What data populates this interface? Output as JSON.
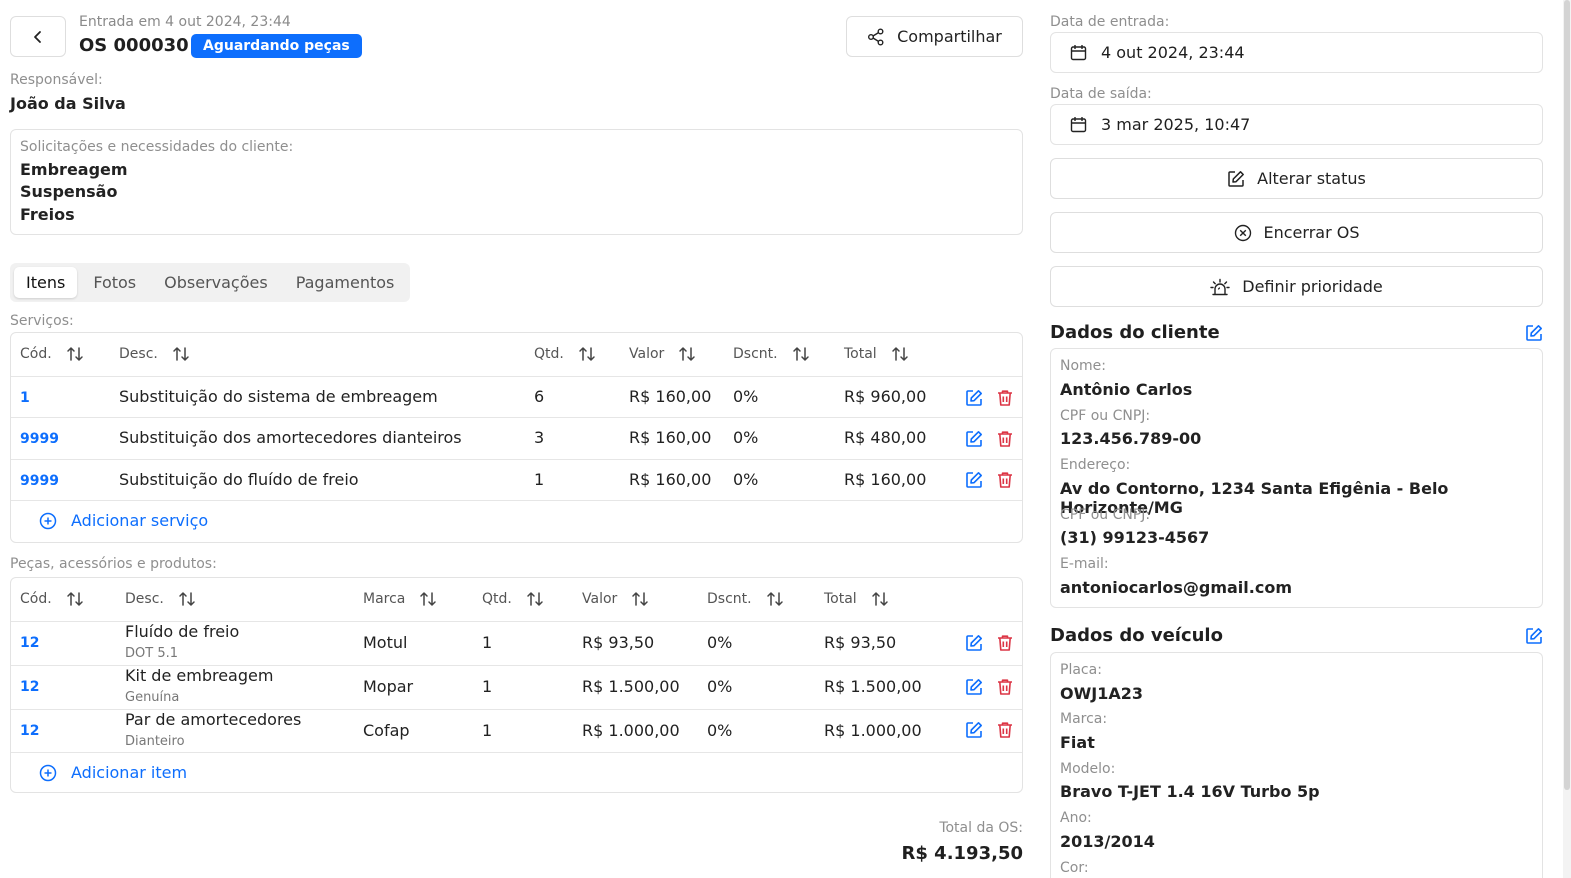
{
  "header": {
    "entry_note": "Entrada em 4 out 2024, 23:44",
    "os_number": "OS 000030",
    "status_badge": "Aguardando peças",
    "share_label": "Compartilhar"
  },
  "responsible": {
    "label": "Responsável:",
    "name": "João da Silva"
  },
  "requests": {
    "label": "Solicitações e necessidades do cliente:",
    "items": [
      "Embreagem",
      "Suspensão",
      "Freios"
    ]
  },
  "tabs": [
    "Itens",
    "Fotos",
    "Observações",
    "Pagamentos"
  ],
  "services": {
    "section_label": "Serviços:",
    "headers": [
      "Cód.",
      "Desc.",
      "Qtd.",
      "Valor",
      "Dscnt.",
      "Total"
    ],
    "rows": [
      {
        "code": "1",
        "desc": "Substituição do sistema de embreagem",
        "qty": "6",
        "value": "R$ 160,00",
        "discount": "0%",
        "total": "R$ 960,00"
      },
      {
        "code": "9999",
        "desc": "Substituição dos amortecedores dianteiros",
        "qty": "3",
        "value": "R$ 160,00",
        "discount": "0%",
        "total": "R$ 480,00"
      },
      {
        "code": "9999",
        "desc": "Substituição do fluído de freio",
        "qty": "1",
        "value": "R$ 160,00",
        "discount": "0%",
        "total": "R$ 160,00"
      }
    ],
    "add_label": "Adicionar serviço"
  },
  "parts": {
    "section_label": "Peças, acessórios e produtos:",
    "headers": [
      "Cód.",
      "Desc.",
      "Marca",
      "Qtd.",
      "Valor",
      "Dscnt.",
      "Total"
    ],
    "rows": [
      {
        "code": "12",
        "desc": "Fluído de freio",
        "sub": "DOT 5.1",
        "brand": "Motul",
        "qty": "1",
        "value": "R$ 93,50",
        "discount": "0%",
        "total": "R$ 93,50"
      },
      {
        "code": "12",
        "desc": "Kit de embreagem",
        "sub": "Genuína",
        "brand": "Mopar",
        "qty": "1",
        "value": "R$ 1.500,00",
        "discount": "0%",
        "total": "R$ 1.500,00"
      },
      {
        "code": "12",
        "desc": "Par de amortecedores",
        "sub": "Dianteiro",
        "brand": "Cofap",
        "qty": "1",
        "value": "R$ 1.000,00",
        "discount": "0%",
        "total": "R$ 1.000,00"
      }
    ],
    "add_label": "Adicionar item"
  },
  "total": {
    "label": "Total da OS:",
    "value": "R$ 4.193,50"
  },
  "dates": {
    "entry_label": "Data de entrada:",
    "entry_value": "4 out 2024, 23:44",
    "exit_label": "Data de saída:",
    "exit_value": "3 mar 2025, 10:47"
  },
  "actions": {
    "change_status": "Alterar status",
    "close_os": "Encerrar OS",
    "set_priority": "Definir prioridade"
  },
  "client": {
    "title": "Dados do cliente",
    "fields": [
      {
        "label": "Nome:",
        "value": "Antônio Carlos"
      },
      {
        "label": "CPF ou CNPJ:",
        "value": "123.456.789-00"
      },
      {
        "label": "Endereço:",
        "value": "Av do Contorno, 1234 Santa Efigênia - Belo Horizonte/MG"
      },
      {
        "label": "CPF ou CNPJ:",
        "value": "(31) 99123-4567"
      },
      {
        "label": "E-mail:",
        "value": "antoniocarlos@gmail.com"
      }
    ]
  },
  "vehicle": {
    "title": "Dados do veículo",
    "fields": [
      {
        "label": "Placa:",
        "value": "OWJ1A23"
      },
      {
        "label": "Marca:",
        "value": "Fiat"
      },
      {
        "label": "Modelo:",
        "value": "Bravo T-JET 1.4 16V Turbo 5p"
      },
      {
        "label": "Ano:",
        "value": "2013/2014"
      },
      {
        "label": "Cor:",
        "value": ""
      }
    ]
  },
  "colors": {
    "accent": "#0d6efd",
    "danger": "#dc3545"
  }
}
